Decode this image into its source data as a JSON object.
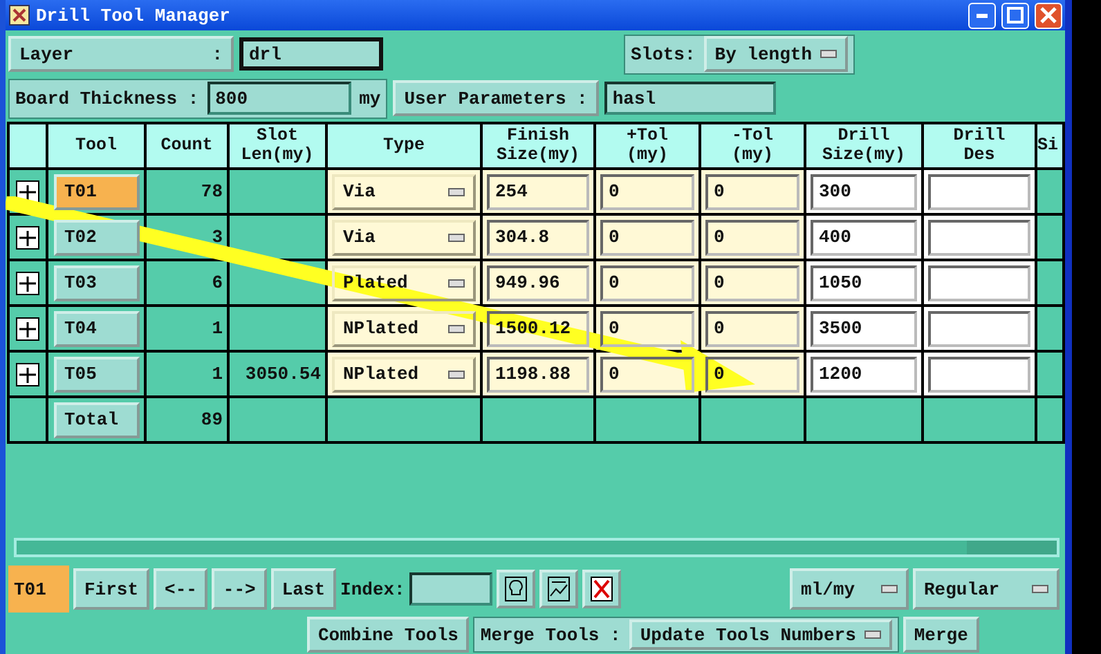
{
  "window": {
    "title": "Drill Tool Manager"
  },
  "layer": {
    "label": "Layer",
    "separator": ":",
    "value": "drl"
  },
  "slots": {
    "label": "Slots:",
    "value": "By length"
  },
  "board_thickness": {
    "label": "Board Thickness :",
    "value": "800",
    "unit": "my"
  },
  "user_parameters": {
    "label": "User Parameters :",
    "value": "hasl"
  },
  "table": {
    "columns": [
      "Tool",
      "Count",
      "Slot Len(my)",
      "Type",
      "Finish Size(my)",
      "+Tol (my)",
      "-Tol (my)",
      "Drill Size(my)",
      "Drill Des",
      "Si"
    ],
    "rows": [
      {
        "tool": "T01",
        "selected": true,
        "count": "78",
        "type": "Via",
        "finish": "254",
        "plus_tol": "0",
        "minus_tol": "0",
        "drill_size": "300"
      },
      {
        "tool": "T02",
        "selected": false,
        "count": "3",
        "type": "Via",
        "finish": "304.8",
        "plus_tol": "0",
        "minus_tol": "0",
        "drill_size": "400"
      },
      {
        "tool": "T03",
        "selected": false,
        "count": "6",
        "type": "Plated",
        "finish": "949.96",
        "plus_tol": "0",
        "minus_tol": "0",
        "drill_size": "1050"
      },
      {
        "tool": "T04",
        "selected": false,
        "count": "1",
        "type": "NPlated",
        "finish": "1500.12",
        "plus_tol": "0",
        "minus_tol": "0",
        "drill_size": "3500"
      },
      {
        "tool": "T05",
        "selected": false,
        "count": "1",
        "slot_len": "3050.54",
        "type": "NPlated",
        "finish": "1198.88",
        "plus_tol": "0",
        "minus_tol": "0",
        "drill_size": "1200"
      }
    ],
    "total": {
      "label": "Total",
      "count": "89"
    }
  },
  "navigation": {
    "current": "T01",
    "buttons": [
      "First",
      "<--",
      "-->",
      "Last"
    ],
    "index_label": "Index:",
    "units": "ml/my",
    "mode": "Regular"
  },
  "actions": {
    "combine": "Combine Tools",
    "merge_label": "Merge Tools :",
    "merge_mode": "Update Tools Numbers",
    "merge": "Merge"
  }
}
